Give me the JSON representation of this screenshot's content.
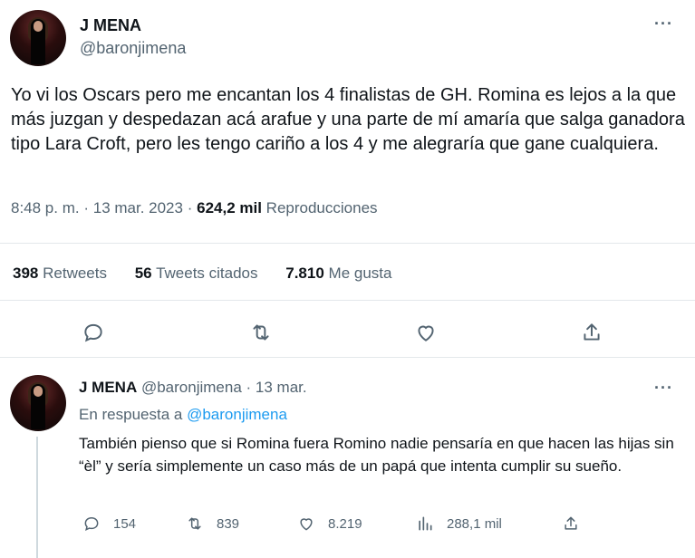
{
  "main_tweet": {
    "author_name": "J MENA",
    "author_handle": "@baronjimena",
    "text": "Yo vi los Oscars pero me encantan los 4 finalistas de GH. Romina es lejos a la que más juzgan y despedazan acá arafue y una parte de mí amaría que salga ganadora tipo Lara Croft, pero les tengo cariño a los 4 y me alegraría que gane cualquiera.",
    "time": "8:48 p. m.",
    "date": "13 mar. 2023",
    "views_count": "624,2 mil",
    "views_label": "Reproducciones",
    "retweets_count": "398",
    "retweets_label": "Retweets",
    "quotes_count": "56",
    "quotes_label": "Tweets citados",
    "likes_count": "7.810",
    "likes_label": "Me gusta"
  },
  "reply_tweet": {
    "author_name": "J MENA",
    "author_handle": "@baronjimena",
    "date": "13 mar.",
    "replying_prefix": "En respuesta a",
    "replying_handle": "@baronjimena",
    "text": "También pienso que si Romina fuera Romino nadie pensaría en que hacen las hijas sin “èl” y sería simplemente un caso más de un papá que intenta cumplir su sueño.",
    "replies": "154",
    "retweets": "839",
    "likes": "8.219",
    "views": "288,1 mil"
  },
  "icons": [
    "reply-icon",
    "retweet-icon",
    "like-icon",
    "share-icon",
    "views-icon",
    "more-icon"
  ],
  "colors": {
    "text": "#0f1419",
    "secondary": "#536471",
    "link": "#1d9bf0",
    "divider": "#e4e8eb"
  }
}
